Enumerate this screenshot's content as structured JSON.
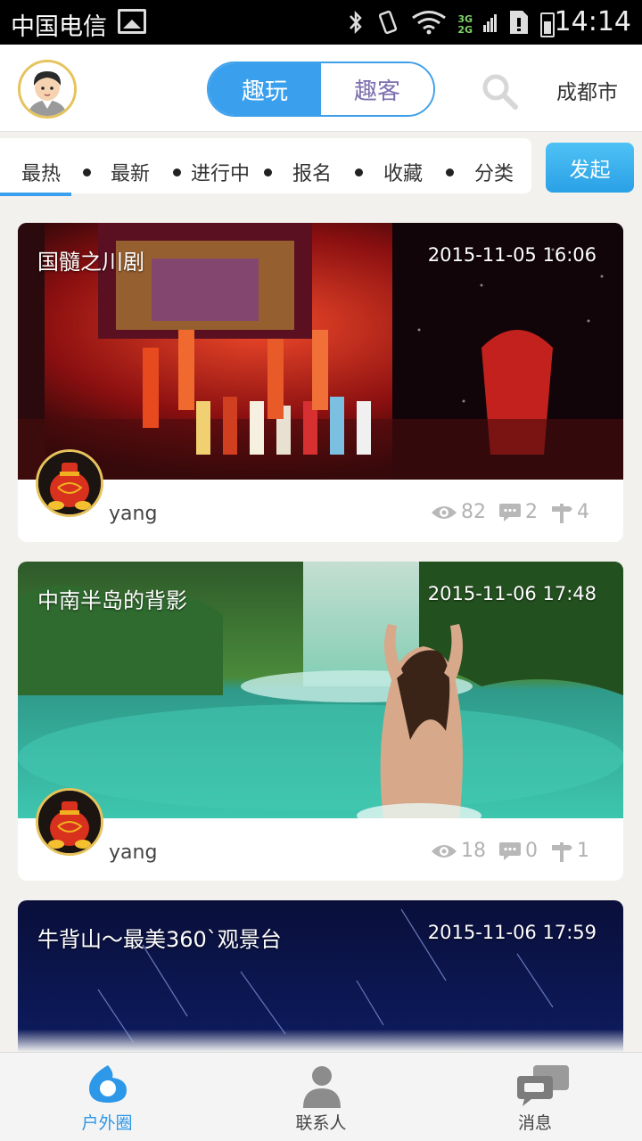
{
  "status_bar": {
    "carrier": "中国电信",
    "network_3g": "3G",
    "network_2g": "2G",
    "time": "14:14"
  },
  "header": {
    "segments": [
      {
        "label": "趣玩",
        "active": true
      },
      {
        "label": "趣客",
        "active": false
      }
    ],
    "city": "成都市"
  },
  "filters": {
    "items": [
      "最热",
      "最新",
      "进行中",
      "报名",
      "收藏",
      "分类"
    ],
    "selected": "最热"
  },
  "launch_label": "发起",
  "cards": [
    {
      "title": "国髓之川剧",
      "date": "2015-11-05 16:06",
      "user": "yang",
      "views": "82",
      "comments": "2",
      "signups": "4"
    },
    {
      "title": "中南半岛的背影",
      "date": "2015-11-06 17:48",
      "user": "yang",
      "views": "18",
      "comments": "0",
      "signups": "1"
    },
    {
      "title": "牛背山～最美360`观景台",
      "date": "2015-11-06 17:59"
    }
  ],
  "bottom_nav": [
    {
      "label": "户外圈",
      "icon": "outdoor-circle-icon",
      "active": true
    },
    {
      "label": "联系人",
      "icon": "contact-person-icon",
      "active": false
    },
    {
      "label": "消息",
      "icon": "message-bubbles-icon",
      "active": false
    }
  ],
  "colors": {
    "accent": "#3aa0ee",
    "inactive_segment_text": "#7d6fb0",
    "stat_gray": "#b2b2b2"
  }
}
